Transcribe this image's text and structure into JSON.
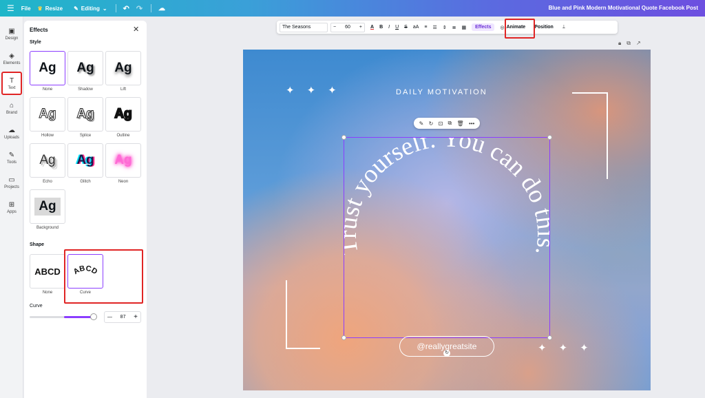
{
  "topbar": {
    "menu_icon": "hamburger-icon",
    "file": "File",
    "resize": "Resize",
    "editing": "Editing",
    "title": "Blue and Pink Modern Motivational Quote Facebook Post"
  },
  "rail": {
    "items": [
      {
        "label": "Design",
        "icon": "layout-icon"
      },
      {
        "label": "Elements",
        "icon": "shapes-icon"
      },
      {
        "label": "Text",
        "icon": "text-icon"
      },
      {
        "label": "Brand",
        "icon": "brand-icon"
      },
      {
        "label": "Uploads",
        "icon": "cloud-upload-icon"
      },
      {
        "label": "Tools",
        "icon": "pen-icon"
      },
      {
        "label": "Projects",
        "icon": "folder-icon"
      },
      {
        "label": "Apps",
        "icon": "apps-icon"
      }
    ]
  },
  "panel": {
    "title": "Effects",
    "style_heading": "Style",
    "styles": [
      {
        "label": "None",
        "glyph": "Ag"
      },
      {
        "label": "Shadow",
        "glyph": "Ag"
      },
      {
        "label": "Lift",
        "glyph": "Ag"
      },
      {
        "label": "Hollow",
        "glyph": "Ag"
      },
      {
        "label": "Splice",
        "glyph": "Ag"
      },
      {
        "label": "Outline",
        "glyph": "Ag"
      },
      {
        "label": "Echo",
        "glyph": "Ag"
      },
      {
        "label": "Glitch",
        "glyph": "Ag"
      },
      {
        "label": "Neon",
        "glyph": "Ag"
      },
      {
        "label": "Background",
        "glyph": "Ag"
      }
    ],
    "shape_heading": "Shape",
    "shapes": [
      {
        "label": "None",
        "glyph": "ABCD"
      },
      {
        "label": "Curve",
        "glyph": "ABCD"
      }
    ],
    "curve_label": "Curve",
    "curve_value": "87"
  },
  "toolbar": {
    "font": "The Seasons",
    "size": "60",
    "minus": "−",
    "plus": "+",
    "color_glyph": "A",
    "bold": "B",
    "italic": "I",
    "underline": "U",
    "strike": "S",
    "case": "aA",
    "effects": "Effects",
    "animate": "Animate",
    "position": "Position"
  },
  "canvas": {
    "heading": "DAILY MOTIVATION",
    "quote": "Trust yourself. You can do this.",
    "handle": "@reallygreatsite"
  },
  "colors": {
    "accent": "#8b3dff",
    "highlight": "#e02424"
  }
}
